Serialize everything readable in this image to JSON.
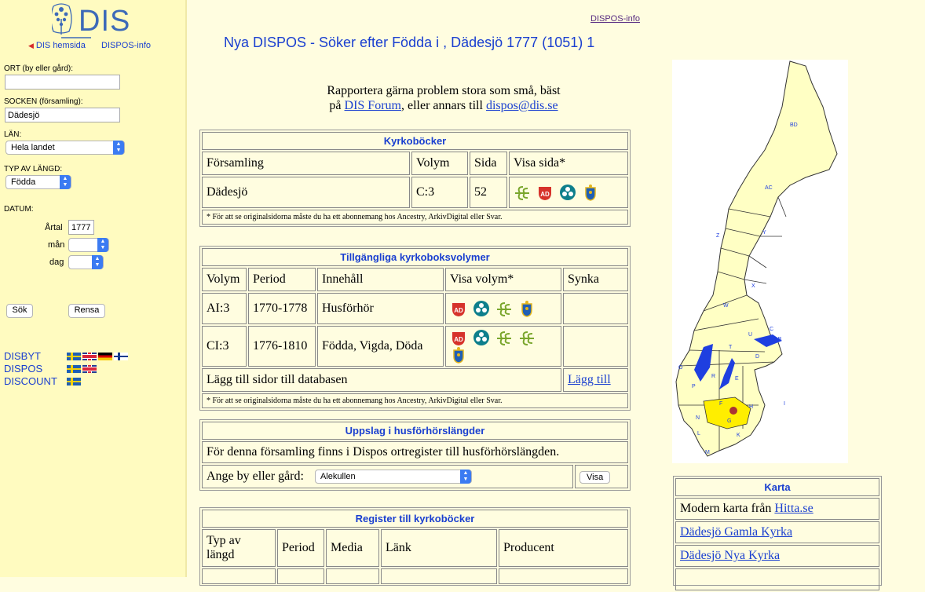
{
  "sidebar": {
    "logo_text": "DIS",
    "links": {
      "dis_hemsida": "DIS hemsida",
      "dispos_info": "DISPOS-info"
    },
    "ort_label": "ORT (by eller gård):",
    "ort_value": "",
    "socken_label": "SOCKEN (församling):",
    "socken_value": "Dädesjö",
    "lan_label": "LÄN:",
    "lan_value": "Hela landet",
    "typ_label": "TYP AV LÄNGD:",
    "typ_value": "Födda",
    "datum_label": "DATUM:",
    "artal_label": "Årtal",
    "artal_value": "1777",
    "man_label": "mån",
    "dag_label": "dag",
    "sok_button": "Sök",
    "rensa_button": "Rensa",
    "nav": [
      "DISBYT",
      "DISPOS",
      "DISCOUNT"
    ]
  },
  "header": {
    "dispos_info": "DISPOS-info",
    "title": "Nya DISPOS - Söker efter Födda i , Dädesjö 1777 (1051) 1"
  },
  "report": {
    "line1": "Rapportera gärna problem stora som små, bäst",
    "pre": "på ",
    "forum_link": "DIS Forum",
    "mid": ", eller annars till ",
    "email_link": "dispos@dis.se"
  },
  "kyrkobocker": {
    "title": "Kyrkoböcker",
    "headers": [
      "Församling",
      "Volym",
      "Sida",
      "Visa sida*"
    ],
    "row": [
      "Dädesjö",
      "C:3",
      "52"
    ],
    "note": "* För att se originalsidorna måste du ha ett abonnemang hos Ancestry, ArkivDigital eller Svar."
  },
  "volymer": {
    "title": "Tillgängliga kyrkoboksvolymer",
    "headers": [
      "Volym",
      "Period",
      "Innehåll",
      "Visa volym*",
      "Synka"
    ],
    "rows": [
      [
        "AI:3",
        "1770-1778",
        "Husförhör"
      ],
      [
        "CI:3",
        "1776-1810",
        "Födda, Vigda, Döda"
      ]
    ],
    "add_text": "Lägg till sidor till databasen",
    "add_link": "Lägg till",
    "note": "* För att se originalsidorna måste du ha ett abonnemang hos Ancestry, ArkivDigital eller Svar."
  },
  "husforhor": {
    "title": "Uppslag i husförhörslängder",
    "text": "För denna församling finns i Dispos ortregister till husförhörslängden.",
    "ange_label": "Ange by eller gård:",
    "select_value": "Alekullen",
    "visa_button": "Visa"
  },
  "register": {
    "title": "Register till kyrkoböcker",
    "headers": [
      "Typ av längd",
      "Period",
      "Media",
      "Länk",
      "Producent"
    ]
  },
  "karta": {
    "title": "Karta",
    "modern_pre": "Modern karta från ",
    "hitta_link": "Hitta.se",
    "links": [
      "Dädesjö Gamla Kyrka",
      "Dädesjö Nya Kyrka"
    ],
    "map_labels": [
      "BD",
      "AC",
      "Z",
      "Y",
      "W",
      "X",
      "C",
      "AB",
      "U",
      "T",
      "D",
      "O",
      "R",
      "E",
      "P",
      "F",
      "H",
      "N",
      "G",
      "I",
      "L",
      "K",
      "M"
    ]
  },
  "colors": {
    "link": "#1a3fd0",
    "sidebar_bg": "#fffbc0",
    "page_bg": "#fffde0",
    "map_land": "#ffffc4",
    "lake": "#1f3fe0",
    "highlight": "#ffee00"
  }
}
